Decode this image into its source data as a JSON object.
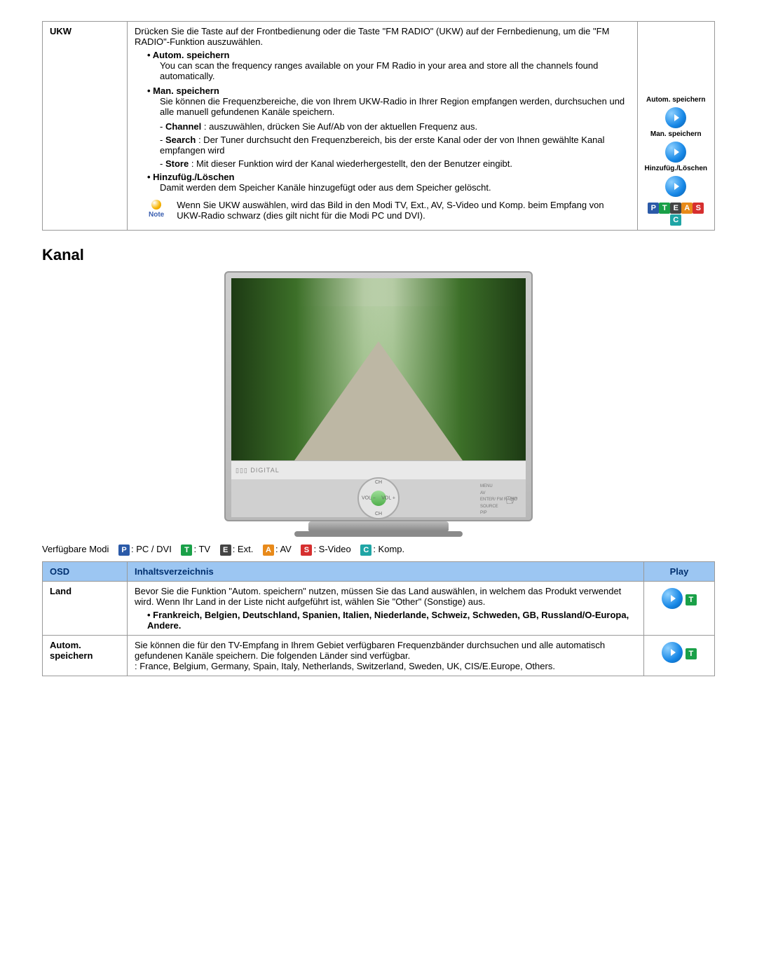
{
  "ukw": {
    "label": "UKW",
    "intro": "Drücken Sie die Taste auf der Frontbedienung oder die Taste \"FM RADIO\" (UKW) auf der Fernbedienung, um die \"FM RADIO\"-Funktion auszuwählen.",
    "items": {
      "autom": {
        "title": "Autom. speichern",
        "body": "You can scan the frequency ranges available on your FM Radio in your area and store all the channels found automatically."
      },
      "man": {
        "title": "Man. speichern",
        "body": "Sie können die Frequenzbereiche, die von Ihrem UKW-Radio in Ihrer Region empfangen werden, durchsuchen und alle manuell gefundenen Kanäle speichern.",
        "channel": {
          "k": "Channel",
          "v": ": auszuwählen, drücken Sie Auf/Ab von der aktuellen Frequenz aus."
        },
        "search": {
          "k": "Search",
          "v": ": Der Tuner durchsucht den Frequenzbereich, bis der erste Kanal oder der von Ihnen gewählte Kanal empfangen wird"
        },
        "store": {
          "k": "Store",
          "v": ": Mit dieser Funktion wird der Kanal wiederhergestellt, den der Benutzer eingibt."
        }
      },
      "hinz": {
        "title": "Hinzufüg./Löschen",
        "body": "Damit werden dem Speicher Kanäle hinzugefügt oder aus dem Speicher gelöscht."
      }
    },
    "note": "Wenn Sie UKW auswählen, wird das Bild in den Modi TV, Ext., AV, S-Video und Komp. beim Empfang von UKW-Radio schwarz (dies gilt nicht für die Modi PC und DVI).",
    "note_label": "Note",
    "sidebar": {
      "a": "Autom. speichern",
      "b": "Man. speichern",
      "c": "Hinzufüg./Löschen"
    }
  },
  "kanal_heading": "Kanal",
  "tv": {
    "ch": "CH",
    "vol_l": "VOL\n−",
    "vol_r": "VOL\n+",
    "btns": [
      "MENU",
      "AV",
      "ENTER/\nFM RADIO",
      "SOURCE",
      "PIP"
    ]
  },
  "modes": {
    "label": "Verfügbare Modi",
    "items": [
      {
        "code": "P",
        "text": ": PC / DVI"
      },
      {
        "code": "T",
        "text": ": TV"
      },
      {
        "code": "E",
        "text": ": Ext."
      },
      {
        "code": "A",
        "text": ": AV"
      },
      {
        "code": "S",
        "text": ": S-Video"
      },
      {
        "code": "C",
        "text": ": Komp."
      }
    ]
  },
  "table": {
    "h1": "OSD",
    "h2": "Inhaltsverzeichnis",
    "h3": "Play",
    "rows": {
      "land": {
        "label": "Land",
        "body": "Bevor Sie die Funktion \"Autom. speichern\" nutzen, müssen Sie das Land auswählen, in welchem das Produkt verwendet wird. Wenn Ihr Land in der Liste nicht aufgeführt ist, wählen Sie \"Other\" (Sonstige) aus.",
        "countries": "Frankreich, Belgien, Deutschland, Spanien, Italien, Niederlande, Schweiz, Schweden, GB, Russland/O-Europa, Andere."
      },
      "autom": {
        "label": "Autom. speichern",
        "body": "Sie können die für den TV-Empfang in Ihrem Gebiet verfügbaren Frequenzbänder durchsuchen und alle automatisch gefundenen Kanäle speichern. Die folgenden Länder sind verfügbar.",
        "list": ": France, Belgium, Germany, Spain, Italy, Netherlands, Switzerland, Sweden, UK, CIS/E.Europe, Others."
      }
    }
  },
  "badges": [
    "P",
    "T",
    "E",
    "A",
    "S",
    "C"
  ]
}
